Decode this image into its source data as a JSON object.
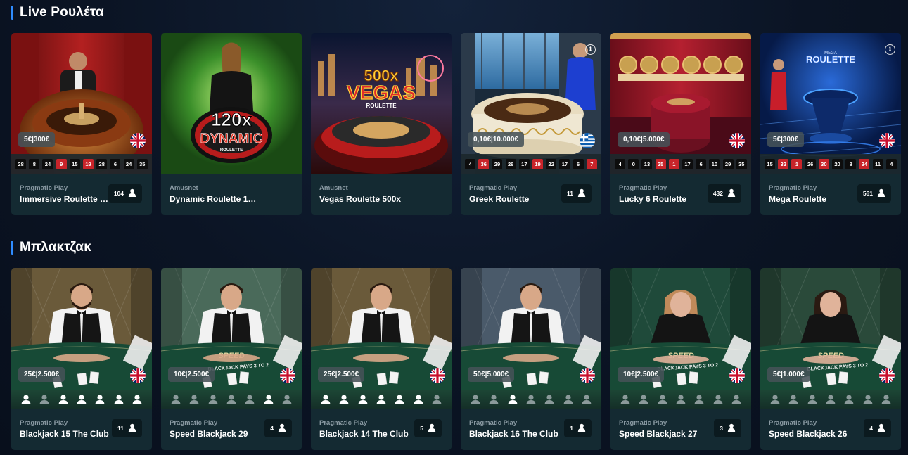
{
  "sections": {
    "roulette": {
      "title": "Live Ρουλέτα",
      "cards": [
        {
          "provider": "Pragmatic Play",
          "name": "Immersive Roulette D...",
          "limit": "5€|300€",
          "players": "104",
          "flag": "uk",
          "numbers": [
            [
              "28",
              "b"
            ],
            [
              "8",
              "b"
            ],
            [
              "24",
              "b"
            ],
            [
              "9",
              "r"
            ],
            [
              "15",
              "b"
            ],
            [
              "19",
              "r"
            ],
            [
              "28",
              "b"
            ],
            [
              "6",
              "b"
            ],
            [
              "24",
              "b"
            ],
            [
              "35",
              "b"
            ]
          ]
        },
        {
          "provider": "Amusnet",
          "name": "Dynamic Roulette 120x",
          "image_text": [
            "120x",
            "DYNAMIC",
            "ROULETTE"
          ]
        },
        {
          "provider": "Amusnet",
          "name": "Vegas Roulette 500x",
          "image_text": [
            "500x",
            "VEGAS",
            "ROULETTE"
          ]
        },
        {
          "provider": "Pragmatic Play",
          "name": "Greek Roulette",
          "limit": "0,10€|10.000€",
          "players": "11",
          "flag": "gr",
          "info": true,
          "numbers": [
            [
              "4",
              "b"
            ],
            [
              "36",
              "r"
            ],
            [
              "29",
              "b"
            ],
            [
              "26",
              "b"
            ],
            [
              "17",
              "b"
            ],
            [
              "19",
              "r"
            ],
            [
              "22",
              "b"
            ],
            [
              "17",
              "b"
            ],
            [
              "6",
              "b"
            ],
            [
              "7",
              "r"
            ]
          ]
        },
        {
          "provider": "Pragmatic Play",
          "name": "Lucky 6 Roulette",
          "limit": "0,10€|5.000€",
          "players": "432",
          "flag": "uk",
          "numbers": [
            [
              "4",
              "b"
            ],
            [
              "0",
              "b"
            ],
            [
              "13",
              "b"
            ],
            [
              "25",
              "r"
            ],
            [
              "1",
              "r"
            ],
            [
              "17",
              "b"
            ],
            [
              "6",
              "b"
            ],
            [
              "10",
              "b"
            ],
            [
              "29",
              "b"
            ],
            [
              "35",
              "b"
            ]
          ]
        },
        {
          "provider": "Pragmatic Play",
          "name": "Mega Roulette",
          "limit": "5€|300€",
          "players": "561",
          "flag": "uk",
          "info": true,
          "image_text": [
            "MEGA",
            "ROULETTE"
          ],
          "numbers": [
            [
              "15",
              "b"
            ],
            [
              "32",
              "r"
            ],
            [
              "1",
              "r"
            ],
            [
              "26",
              "b"
            ],
            [
              "30",
              "r"
            ],
            [
              "20",
              "b"
            ],
            [
              "8",
              "b"
            ],
            [
              "34",
              "r"
            ],
            [
              "11",
              "b"
            ],
            [
              "4",
              "b"
            ]
          ]
        }
      ]
    },
    "blackjack": {
      "title": "Μπλακτζακ",
      "cards": [
        {
          "provider": "Pragmatic Play",
          "name": "Blackjack 15 The Club",
          "limit": "25€|2.500€",
          "players": "11",
          "flag": "uk",
          "seats": [
            1,
            0,
            1,
            1,
            1,
            1,
            1
          ],
          "dealer": "m1"
        },
        {
          "provider": "Pragmatic Play",
          "name": "Speed Blackjack 29",
          "limit": "10€|2.500€",
          "players": "4",
          "flag": "uk",
          "seats": [
            0,
            0,
            0,
            0,
            0,
            1,
            0
          ],
          "dealer": "m2",
          "image_text": [
            "SPEED",
            "BLACKJACK PAYS 3 TO 2"
          ]
        },
        {
          "provider": "Pragmatic Play",
          "name": "Blackjack 14 The Club",
          "limit": "25€|2.500€",
          "players": "5",
          "flag": "uk",
          "seats": [
            1,
            1,
            1,
            1,
            1,
            1,
            0
          ],
          "dealer": "m3"
        },
        {
          "provider": "Pragmatic Play",
          "name": "Blackjack 16 The Club",
          "limit": "50€|5.000€",
          "players": "1",
          "flag": "uk",
          "seats": [
            0,
            0,
            1,
            0,
            0,
            0,
            0
          ],
          "dealer": "m4"
        },
        {
          "provider": "Pragmatic Play",
          "name": "Speed Blackjack 27",
          "limit": "10€|2.500€",
          "players": "3",
          "flag": "uk",
          "seats": [
            0,
            0,
            0,
            0,
            0,
            0,
            0
          ],
          "dealer": "f1",
          "image_text": [
            "SPEED",
            "BLACKJACK PAYS 3 TO 2"
          ]
        },
        {
          "provider": "Pragmatic Play",
          "name": "Speed Blackjack 26",
          "limit": "5€|1.000€",
          "players": "4",
          "flag": "uk",
          "seats": [
            0,
            0,
            0,
            0,
            0,
            0,
            0
          ],
          "dealer": "f2",
          "image_text": [
            "SPEED",
            "BLACKJACK PAYS 3 TO 2"
          ]
        }
      ]
    }
  },
  "colors": {
    "accent": "#2f8cff",
    "card_bg": "#142a32",
    "red": "#c9242a",
    "black": "#0d0d0d"
  }
}
